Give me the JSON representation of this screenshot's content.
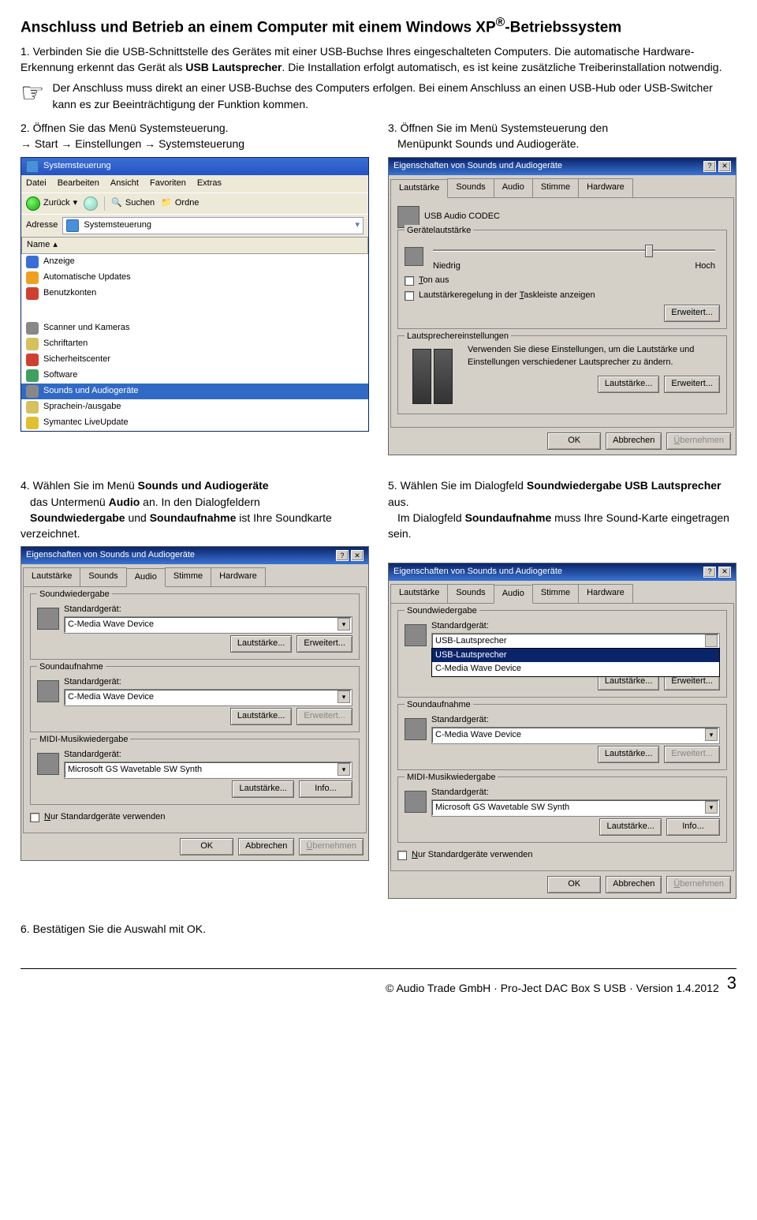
{
  "doc": {
    "title_a": "Anschluss und Betrieb an einem Computer mit einem Windows XP",
    "title_b": "-Betriebssystem",
    "sup": "®",
    "step1": "1. Verbinden Sie die USB-Schnittstelle des Gerätes mit einer USB-Buchse Ihres eingeschalteten Computers. Die automatische Hardware-Erkennung erkennt das Gerät als ",
    "step1_b": "USB Lautsprecher",
    "step1_c": ". Die Installation erfolgt automatisch, es ist keine zusätzliche Treiberinstallation notwendig.",
    "note": "Der Anschluss muss direkt an einer USB-Buchse des Computers erfolgen. Bei einem Anschluss an einen USB-Hub oder USB-Switcher kann es zur Beeinträchtigung der Funktion kommen.",
    "step2": "2. Öffnen Sie das Menü Systemsteuerung.",
    "step2_path": "→ Start → Einstellungen → Systemsteuerung",
    "step3_a": "3. Öffnen Sie im Menü Systemsteuerung den",
    "step3_b": "Menüpunkt Sounds und Audiogeräte.",
    "step4_a": "4. Wählen Sie im Menü ",
    "step4_b": "Sounds und Audiogeräte",
    "step4_c": " das Untermenü ",
    "step4_d": "Audio",
    "step4_e": " an. In den Dialogfeldern ",
    "step4_f": "Soundwiedergabe",
    "step4_g": " und ",
    "step4_h": "Soundaufnahme",
    "step4_i": " ist Ihre Soundkarte verzeichnet.",
    "step5_a": "5. Wählen Sie im Dialogfeld ",
    "step5_b": "Soundwiedergabe USB Lautsprecher",
    "step5_c": " aus.",
    "step5_d": "Im Dialogfeld ",
    "step5_e": "Soundaufnahme",
    "step5_f": " muss Ihre Sound-Karte eingetragen sein.",
    "step6": "6. Bestätigen Sie die Auswahl mit OK.",
    "footer": "© Audio Trade GmbH · Pro-Ject DAC Box S USB · Version 1.4.2012",
    "page": "3"
  },
  "explorer": {
    "title": "Systemsteuerung",
    "menu": [
      "Datei",
      "Bearbeiten",
      "Ansicht",
      "Favoriten",
      "Extras"
    ],
    "back": "Zurück",
    "search": "Suchen",
    "folders": "Ordne",
    "addr_label": "Adresse",
    "addr_val": "Systemsteuerung",
    "name_col": "Name",
    "items1": [
      {
        "t": "Anzeige",
        "c": "#3b6ed5"
      },
      {
        "t": "Automatische Updates",
        "c": "#f0a020"
      },
      {
        "t": "Benutzkonten",
        "c": "#d04030"
      }
    ],
    "items2": [
      {
        "t": "Scanner und Kameras",
        "c": "#888"
      },
      {
        "t": "Schriftarten",
        "c": "#d6c060"
      },
      {
        "t": "Sicherheitscenter",
        "c": "#d04030"
      },
      {
        "t": "Software",
        "c": "#40a060"
      },
      {
        "t": "Sounds und Audiogeräte",
        "c": "#888",
        "sel": true,
        "t2": "Sounds und Audiogeräte"
      },
      {
        "t": "Sprachein-/ausgabe",
        "c": "#d6c060"
      },
      {
        "t": "Symantec LiveUpdate",
        "c": "#e0c030"
      }
    ]
  },
  "dlg1": {
    "title": "Eigenschaften von Sounds und Audiogeräte",
    "tabs": [
      "Lautstärke",
      "Sounds",
      "Audio",
      "Stimme",
      "Hardware"
    ],
    "active": 0,
    "codec": "USB Audio CODEC",
    "fs1": "Gerätelautstärke",
    "low": "Niedrig",
    "high": "Hoch",
    "mute_u": "T",
    "mute": "on aus",
    "tray_u": "T",
    "tray": "askleiste anzeigen",
    "tray_pre": "Lautstärkeregelung in der ",
    "adv": "Erweitert...",
    "fs2": "Lautsprechereinstellungen",
    "spktxt": "Verwenden Sie diese Einstellungen, um die Lautstärke und Einstellungen verschiedener Lautsprecher zu ändern.",
    "lbtn": "Lautstärke...",
    "ebtn": "Erweitert..."
  },
  "dlg2": {
    "title": "Eigenschaften von Sounds und Audiogeräte",
    "tabs": [
      "Lautstärke",
      "Sounds",
      "Audio",
      "Stimme",
      "Hardware"
    ],
    "active": 2,
    "fs_play": "Soundwiedergabe",
    "fs_rec": "Soundaufnahme",
    "fs_midi": "MIDI-Musikwiedergabe",
    "std": "Standardgerät:",
    "dev1": "C-Media Wave Device",
    "dev2": "C-Media Wave Device",
    "dev3": "Microsoft GS Wavetable SW Synth",
    "lbtn": "Lautstärke...",
    "ebtn": "Erweitert...",
    "ibtn": "Info...",
    "only_u": "N",
    "only": "ur Standardgeräte verwenden"
  },
  "dlg3": {
    "title": "Eigenschaften von Sounds und Audiogeräte",
    "tabs": [
      "Lautstärke",
      "Sounds",
      "Audio",
      "Stimme",
      "Hardware"
    ],
    "active": 2,
    "fs_play": "Soundwiedergabe",
    "fs_rec": "Soundaufnahme",
    "fs_midi": "MIDI-Musikwiedergabe",
    "std": "Standardgerät:",
    "dev1": "USB-Lautsprecher",
    "dev_dd1": "USB-Lautsprecher",
    "dev_dd2": "C-Media Wave Device",
    "dev2": "C-Media Wave Device",
    "dev3": "Microsoft GS Wavetable SW Synth",
    "lbtn": "Lautstärke...",
    "ebtn": "Erweitert...",
    "ibtn": "Info...",
    "only_u": "N",
    "only": "ur Standardgeräte verwenden"
  },
  "common": {
    "ok": "OK",
    "cancel": "Abbrechen",
    "apply": "Übernehmen",
    "apply_u": "Ü",
    "apply_rest": "bernehmen"
  }
}
